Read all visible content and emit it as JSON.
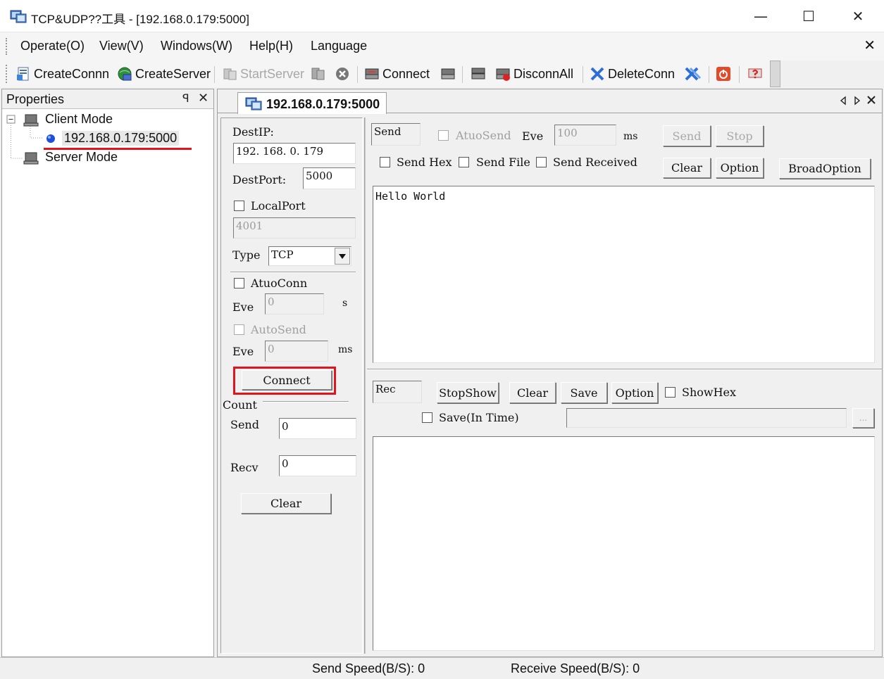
{
  "window": {
    "title": "TCP&UDP??工具 - [192.168.0.179:5000]",
    "minimize_label": "—",
    "maximize_label": "☐",
    "close_label": "✕"
  },
  "menubar": {
    "items": [
      "Operate(O)",
      "View(V)",
      "Windows(W)",
      "Help(H)",
      "Language"
    ],
    "close_label": "✕"
  },
  "toolbar": {
    "create_conn": "CreateConnn",
    "create_server": "CreateServer",
    "start_server": "StartServer",
    "connect": "Connect",
    "disconn_all": "DisconnAll",
    "delete_conn": "DeleteConn"
  },
  "properties": {
    "title": "Properties",
    "pin_label": "ꟼ",
    "close_label": "✕",
    "tree": {
      "client_mode": "Client Mode",
      "connection": "192.168.0.179:5000",
      "server_mode": "Server Mode"
    }
  },
  "tab": {
    "label": "192.168.0.179:5000"
  },
  "settings": {
    "dest_ip_label": "DestIP:",
    "dest_ip_value": "192. 168. 0. 179",
    "dest_port_label": "DestPort:",
    "dest_port_value": "5000",
    "local_port_label": "LocalPort",
    "local_port_value": "4001",
    "type_label": "Type",
    "type_value": "TCP",
    "auto_conn_label": "AtuoConn",
    "eve_label": "Eve",
    "auto_conn_interval": "0",
    "auto_conn_unit": "s",
    "auto_send_label": "AutoSend",
    "eve2_label": "Eve",
    "auto_send_interval": "0",
    "auto_send_unit": "ms",
    "connect_button": "Connect",
    "count_label": "Count",
    "send_label": "Send",
    "send_count": "0",
    "recv_label": "Recv",
    "recv_count": "0",
    "clear_button": "Clear"
  },
  "send_panel": {
    "send_title": "Send",
    "auto_send_label": "AtuoSend",
    "eve_label": "Eve",
    "interval_value": "100",
    "interval_unit": "ms",
    "send_button": "Send",
    "stop_button": "Stop",
    "send_hex_label": "Send Hex",
    "send_file_label": "Send File",
    "send_received_label": "Send Received",
    "clear_button": "Clear",
    "option_button": "Option",
    "broad_option_button": "BroadOption",
    "content": "Hello World"
  },
  "recv_panel": {
    "rec_title": "Rec",
    "stop_show_button": "StopShow",
    "clear_button": "Clear",
    "save_button": "Save",
    "option_button": "Option",
    "show_hex_label": "ShowHex",
    "save_in_time_label": "Save(In Time)",
    "save_path_value": "",
    "browse_button": "...",
    "content": ""
  },
  "statusbar": {
    "send_speed": "Send Speed(B/S): 0",
    "receive_speed": "Receive Speed(B/S): 0"
  },
  "colors": {
    "highlight_red": "#e0141e",
    "tree_node_blue": "#1f4fd8"
  }
}
